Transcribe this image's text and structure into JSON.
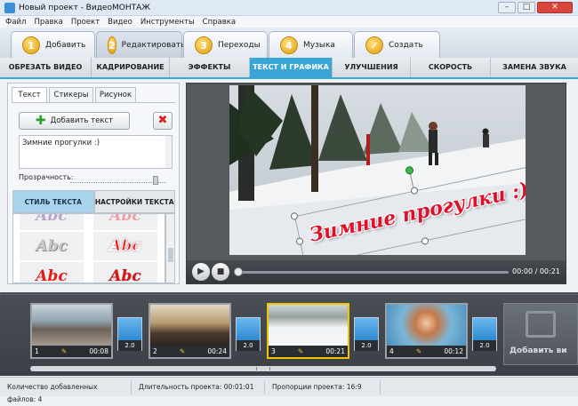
{
  "window": {
    "title": "Новый проект - ВидеоМОНТАЖ",
    "controls": [
      "–",
      "□",
      "✕"
    ]
  },
  "menu": [
    "Файл",
    "Правка",
    "Проект",
    "Видео",
    "Инструменты",
    "Справка"
  ],
  "steps": [
    {
      "num": "1",
      "label": "Добавить"
    },
    {
      "num": "2",
      "label": "Редактировать"
    },
    {
      "num": "3",
      "label": "Переходы"
    },
    {
      "num": "4",
      "label": "Музыка"
    },
    {
      "num": "✓",
      "label": "Создать"
    }
  ],
  "tabs": [
    "ОБРЕЗАТЬ ВИДЕО",
    "КАДРИРОВАНИЕ",
    "ЭФФЕКТЫ",
    "ТЕКСТ И ГРАФИКА",
    "УЛУЧШЕНИЯ",
    "СКОРОСТЬ",
    "ЗАМЕНА ЗВУКА"
  ],
  "active_tab": "ТЕКСТ И ГРАФИКА",
  "left_panel": {
    "subtabs": [
      "Текст",
      "Стикеры",
      "Рисунок"
    ],
    "add_text_label": "Добавить текст",
    "text_value": "Зимние прогулки :)",
    "transparency_label": "Прозрачность:",
    "style_tabs": [
      "СТИЛЬ ТЕКСТА",
      "НАСТРОЙКИ ТЕКСТА"
    ],
    "style_samples": [
      "Abc",
      "Abc",
      "Abc",
      "Abc",
      "Abc",
      "Abc"
    ]
  },
  "preview": {
    "overlay_text": "Зимние прогулки :)",
    "time": "00:00 / 00:21"
  },
  "timeline": {
    "clips": [
      {
        "num": "1",
        "duration": "00:08"
      },
      {
        "num": "2",
        "duration": "00:24"
      },
      {
        "num": "3",
        "duration": "00:21"
      },
      {
        "num": "4",
        "duration": "00:12"
      }
    ],
    "transitions": [
      "2.0",
      "2.0",
      "2.0",
      "2.0"
    ],
    "add_video_label": "Добавить ви"
  },
  "status": {
    "files": "Количество добавленных файлов: 4",
    "duration": "Длительность проекта: 00:01:01",
    "aspect": "Пропорции проекта: 16:9"
  },
  "colors": {
    "accent": "#3aa6d6",
    "selected_clip": "#f1c400",
    "overlay_text": "#e0102a"
  }
}
